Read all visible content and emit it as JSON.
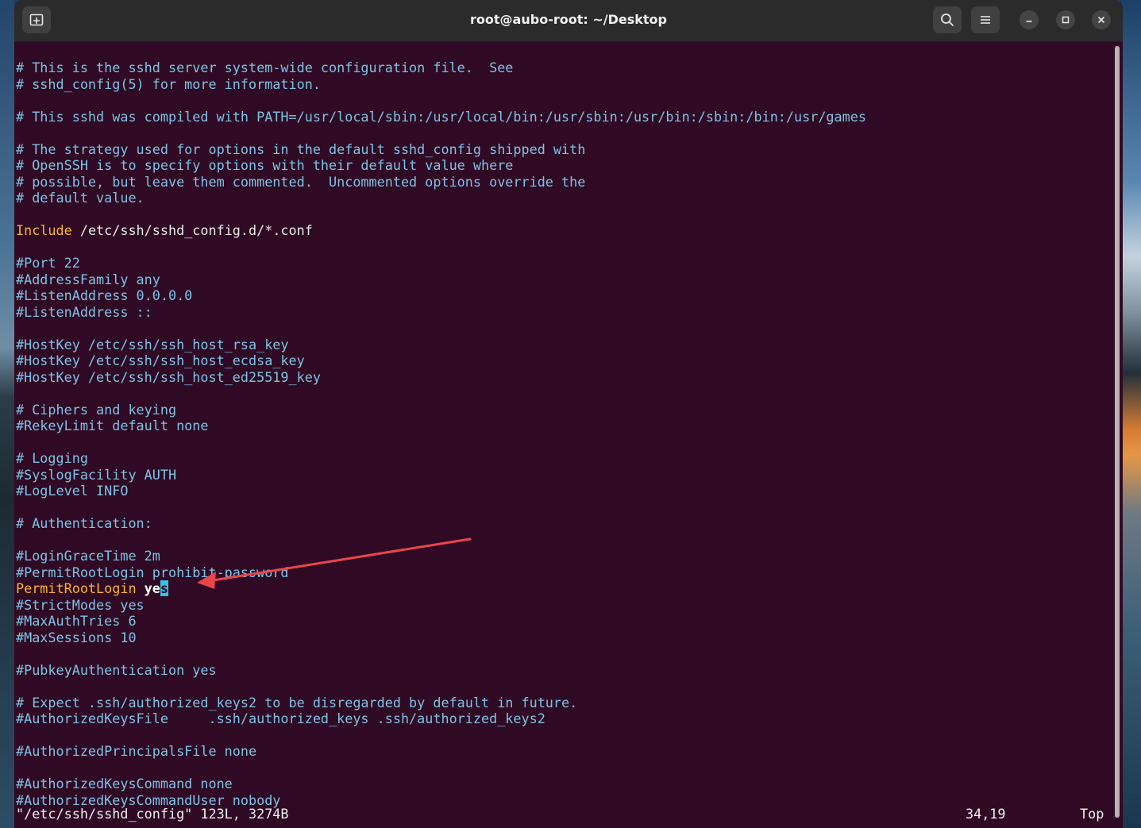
{
  "window": {
    "title": "root@aubo-root: ~/Desktop"
  },
  "icons": {
    "new_tab": "new-tab-icon",
    "search": "search-icon",
    "menu": "hamburger-menu-icon",
    "minimize": "minimize-icon",
    "maximize": "maximize-icon",
    "close": "close-icon"
  },
  "colors": {
    "terminal_bg": "#300a24",
    "comment": "#7fc2e5",
    "keyword": "#f6b62b",
    "cursor": "#34c3e8",
    "annotation_arrow": "#e8464b"
  },
  "editor": {
    "lines": [
      "# This is the sshd server system-wide configuration file.  See",
      "# sshd_config(5) for more information.",
      "",
      "# This sshd was compiled with PATH=/usr/local/sbin:/usr/local/bin:/usr/sbin:/usr/bin:/sbin:/bin:/usr/games",
      "",
      "# The strategy used for options in the default sshd_config shipped with",
      "# OpenSSH is to specify options with their default value where",
      "# possible, but leave them commented.  Uncommented options override the",
      "# default value.",
      "",
      "Include /etc/ssh/sshd_config.d/*.conf",
      "",
      "#Port 22",
      "#AddressFamily any",
      "#ListenAddress 0.0.0.0",
      "#ListenAddress ::",
      "",
      "#HostKey /etc/ssh/ssh_host_rsa_key",
      "#HostKey /etc/ssh/ssh_host_ecdsa_key",
      "#HostKey /etc/ssh/ssh_host_ed25519_key",
      "",
      "# Ciphers and keying",
      "#RekeyLimit default none",
      "",
      "# Logging",
      "#SyslogFacility AUTH",
      "#LogLevel INFO",
      "",
      "# Authentication:",
      "",
      "#LoginGraceTime 2m",
      "#PermitRootLogin prohibit-password",
      "PermitRootLogin yes",
      "#StrictModes yes",
      "#MaxAuthTries 6",
      "#MaxSessions 10",
      "",
      "#PubkeyAuthentication yes",
      "",
      "# Expect .ssh/authorized_keys2 to be disregarded by default in future.",
      "#AuthorizedKeysFile     .ssh/authorized_keys .ssh/authorized_keys2",
      "",
      "#AuthorizedPrincipalsFile none",
      "",
      "#AuthorizedKeysCommand none",
      "#AuthorizedKeysCommandUser nobody"
    ],
    "include_keyword": "Include",
    "include_value": " /etc/ssh/sshd_config.d/*.conf",
    "permit_keyword": "PermitRootLogin",
    "permit_value_before_cursor": "ye",
    "permit_cursor_char": "s"
  },
  "status": {
    "file_info": "\"/etc/ssh/sshd_config\" 123L, 3274B",
    "cursor_position": "34,19",
    "scroll_position": "Top"
  }
}
